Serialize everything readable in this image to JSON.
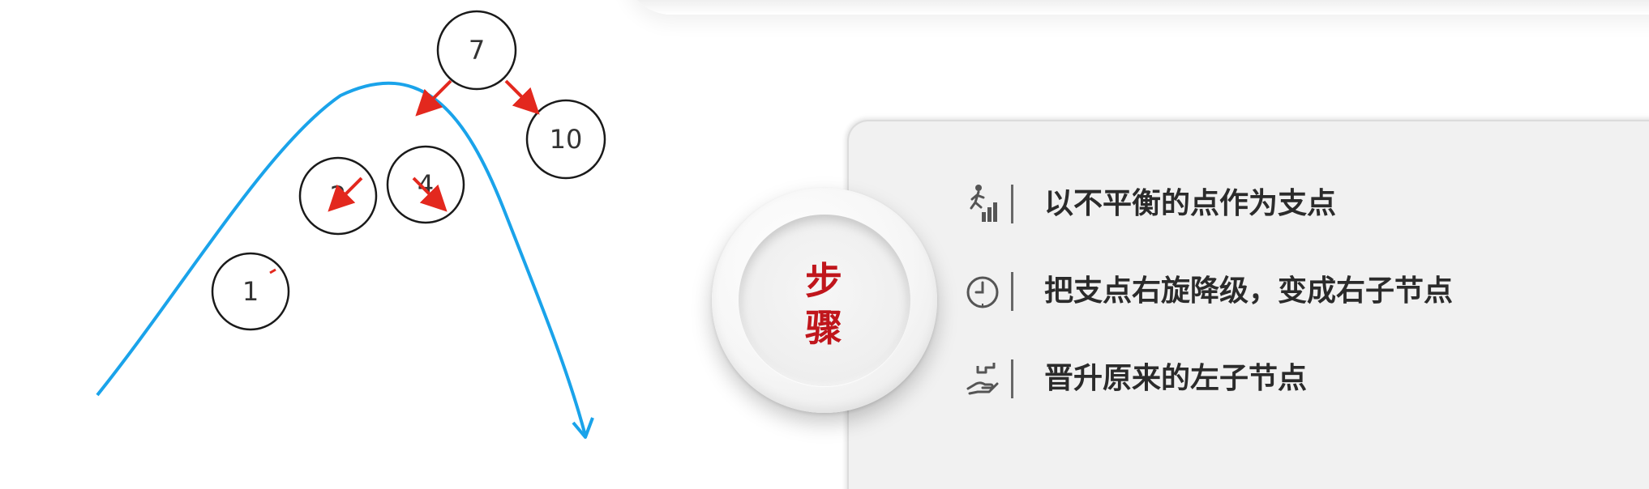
{
  "diagram": {
    "nodes": [
      {
        "id": "node-7",
        "label": "7"
      },
      {
        "id": "node-10",
        "label": "10"
      },
      {
        "id": "node-2",
        "label": "2"
      },
      {
        "id": "node-4",
        "label": "4"
      },
      {
        "id": "node-1",
        "label": "1"
      }
    ]
  },
  "badge": {
    "char1": "步",
    "char2": "骤"
  },
  "steps": [
    {
      "icon": "walking-person-bars-icon",
      "text": "以不平衡的点作为支点"
    },
    {
      "icon": "clock-icon",
      "text": "把支点右旋降级，变成右子节点"
    },
    {
      "icon": "hand-with-steps-icon",
      "text": "晋升原来的左子节点"
    }
  ],
  "colors": {
    "arrow_red": "#e3281e",
    "curve_blue": "#1aa3ea",
    "badge_red": "#c0161c",
    "text_dark": "#2b2b2b",
    "icon_gray": "#555555"
  }
}
